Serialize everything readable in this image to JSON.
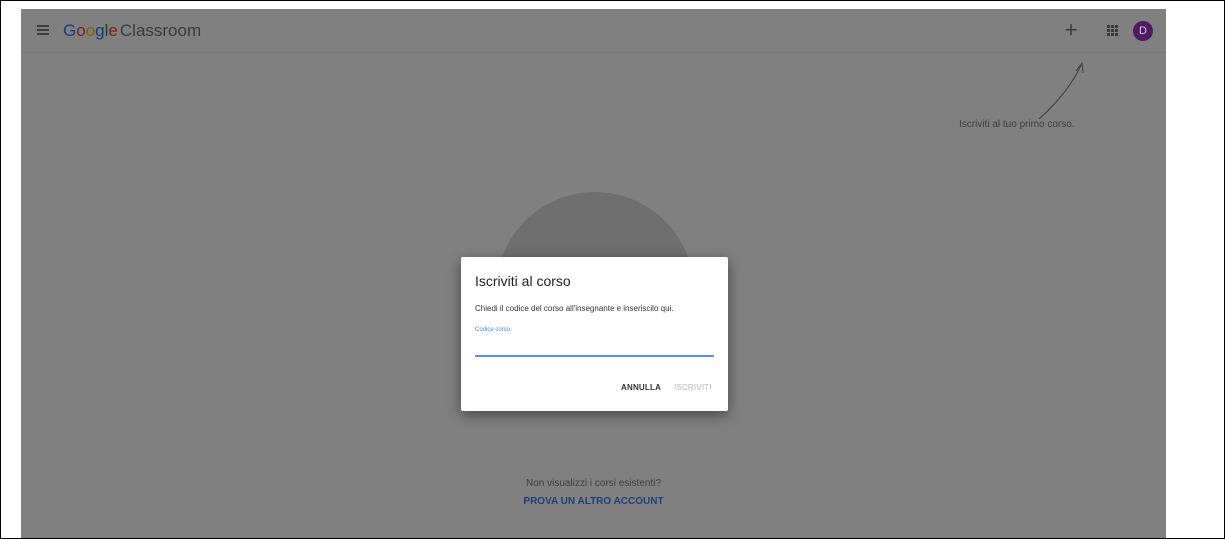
{
  "appbar": {
    "brand": {
      "g1": "G",
      "g2": "o",
      "g3": "o",
      "g4": "g",
      "g5": "l",
      "g6": "e",
      "product": "Classroom"
    },
    "plus_label": "+",
    "avatar_initial": "D"
  },
  "hint": {
    "text": "Iscriviti al tuo primo corso."
  },
  "empty_state": {
    "message": "Non visualizzi i corsi esistenti?",
    "alt_account_link": "PROVA UN ALTRO ACCOUNT"
  },
  "dialog": {
    "title": "Iscriviti al corso",
    "description": "Chiedi il codice del corso all'insegnante e inseriscilo qui.",
    "field_label": "Codice corso",
    "field_value": "",
    "cancel_label": "ANNULLA",
    "join_label": "ISCRIVITI"
  },
  "colors": {
    "overlay": "#808080",
    "accent": "#4285f4",
    "link": "#1f3f78",
    "avatar": "#4e1b63"
  }
}
